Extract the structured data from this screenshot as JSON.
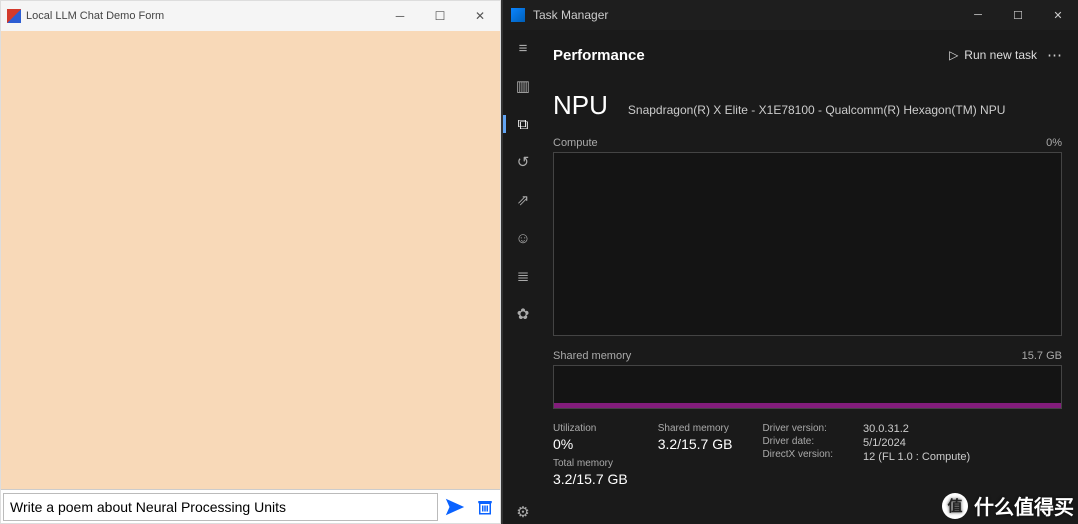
{
  "left": {
    "title": "Local LLM Chat Demo Form",
    "input_value": "Write a poem about Neural Processing Units"
  },
  "right": {
    "title": "Task Manager",
    "tab": "Performance",
    "run_new": "Run new task",
    "npu_label": "NPU",
    "npu_sub": "Snapdragon(R) X Elite - X1E78100 - Qualcomm(R) Hexagon(TM) NPU",
    "compute_label": "Compute",
    "compute_max": "0%",
    "shared_label": "Shared memory",
    "shared_max": "15.7 GB",
    "stats": {
      "util_lbl": "Utilization",
      "util_val": "0%",
      "totmem_lbl": "Total memory",
      "totmem_val": "3.2/15.7 GB",
      "shmem_lbl": "Shared memory",
      "shmem_val": "3.2/15.7 GB",
      "drvver_lbl": "Driver version:",
      "drvver_val": "30.0.31.2",
      "drvdate_lbl": "Driver date:",
      "drvdate_val": "5/1/2024",
      "dxver_lbl": "DirectX version:",
      "dxver_val": "12 (FL 1.0 : Compute)"
    }
  },
  "watermark": {
    "circ": "值",
    "text": "什么值得买"
  },
  "chart_data": [
    {
      "type": "area",
      "title": "Compute",
      "ylabel": "%",
      "ylim": [
        0,
        100
      ],
      "x": [
        0,
        1,
        2,
        3,
        4,
        5,
        6,
        7,
        8,
        9,
        10,
        11,
        12,
        13,
        14,
        15,
        16,
        17,
        18,
        19,
        20,
        21,
        22,
        23,
        24,
        25,
        26,
        27,
        28,
        29,
        30,
        31,
        32,
        33,
        34,
        35,
        36,
        37,
        38,
        39,
        40,
        41,
        42,
        43,
        44,
        45,
        46,
        47,
        48,
        49,
        50,
        51,
        52,
        53,
        54,
        55,
        56,
        57,
        58,
        59
      ],
      "values": [
        0,
        0,
        0,
        0,
        0,
        0,
        0,
        0,
        0,
        0,
        0,
        0,
        0,
        0,
        0,
        0,
        0,
        0,
        0,
        0,
        0,
        0,
        0,
        0,
        0,
        0,
        0,
        0,
        0,
        0,
        0,
        0,
        0,
        0,
        0,
        0,
        0,
        0,
        0,
        0,
        0,
        0,
        0,
        0,
        0,
        0,
        0,
        0,
        0,
        0,
        0,
        0,
        0,
        0,
        0,
        0,
        0,
        0,
        0,
        0
      ]
    },
    {
      "type": "area",
      "title": "Shared memory",
      "ylabel": "GB",
      "ylim": [
        0,
        15.7
      ],
      "x": [
        0,
        1,
        2,
        3,
        4,
        5,
        6,
        7,
        8,
        9,
        10,
        11,
        12,
        13,
        14,
        15,
        16,
        17,
        18,
        19,
        20,
        21,
        22,
        23,
        24,
        25,
        26,
        27,
        28,
        29,
        30,
        31,
        32,
        33,
        34,
        35,
        36,
        37,
        38,
        39,
        40,
        41,
        42,
        43,
        44,
        45,
        46,
        47,
        48,
        49,
        50,
        51,
        52,
        53,
        54,
        55,
        56,
        57,
        58,
        59
      ],
      "values": [
        3.2,
        3.2,
        3.2,
        3.2,
        3.2,
        3.2,
        3.2,
        3.2,
        3.2,
        3.2,
        3.2,
        3.2,
        3.2,
        3.2,
        3.2,
        3.2,
        3.2,
        3.2,
        3.2,
        3.2,
        3.2,
        3.2,
        3.2,
        3.2,
        3.2,
        3.2,
        3.2,
        3.2,
        3.2,
        3.2,
        3.2,
        3.2,
        3.2,
        3.2,
        3.2,
        3.2,
        3.2,
        3.2,
        3.2,
        3.2,
        3.2,
        3.2,
        3.2,
        3.2,
        3.2,
        3.2,
        3.2,
        3.2,
        3.2,
        3.2,
        3.2,
        3.2,
        3.2,
        3.2,
        3.2,
        3.2,
        3.2,
        3.2,
        3.2,
        3.2
      ]
    }
  ]
}
